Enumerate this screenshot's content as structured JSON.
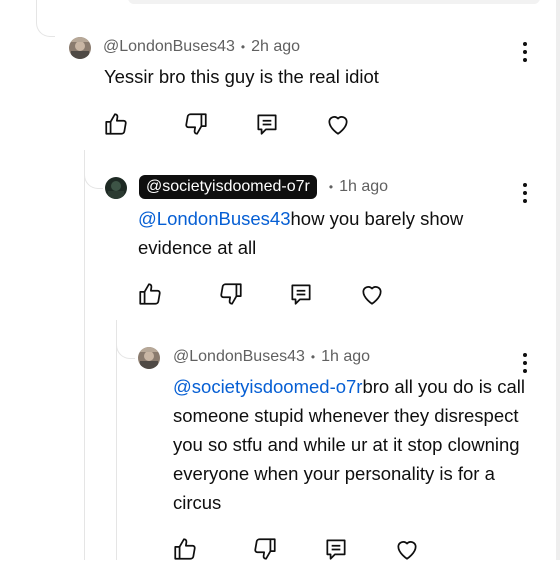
{
  "comments": [
    {
      "handle": "@LondonBuses43",
      "time": "2h ago",
      "text_mention": "",
      "text": "Yessir bro this guy is the real idiot"
    },
    {
      "handle": "@societyisdoomed-o7r",
      "time": "1h ago",
      "text_mention": "@LondonBuses43",
      "text": "how you barely show evidence at all"
    },
    {
      "handle": "@LondonBuses43",
      "time": "1h ago",
      "text_mention": "@societyisdoomed-o7r",
      "text": "bro all you do is call someone stupid whenever they disrespect you so stfu and while ur at it stop clowning everyone when your personality is for a circus"
    }
  ],
  "separator": "•",
  "icons": [
    "like-icon",
    "dislike-icon",
    "reply-icon",
    "heart-icon",
    "more-options-icon"
  ]
}
